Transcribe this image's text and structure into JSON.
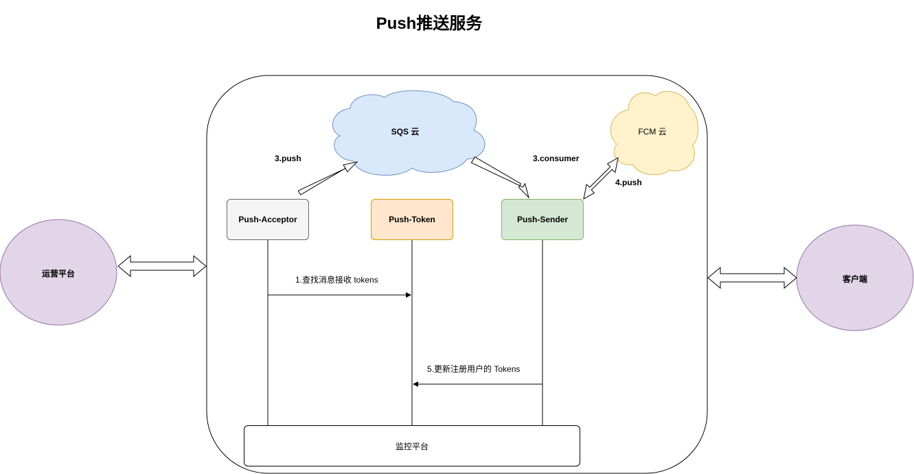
{
  "title": "Push推送服务",
  "nodes": {
    "ops_platform": "运营平台",
    "client": "客户端",
    "sqs_cloud": "SQS 云",
    "fcm_cloud": "FCM 云",
    "push_acceptor": "Push-Acceptor",
    "push_token": "Push-Token",
    "push_sender": "Push-Sender",
    "monitor_platform": "监控平台"
  },
  "edge_labels": {
    "push_to_sqs": "3.push",
    "sqs_consumer": "3.consumer",
    "fcm_push": "4.push",
    "lookup_tokens": "1.查找消息接收 tokens",
    "update_tokens": "5.更新注册用户的 Tokens"
  },
  "colors": {
    "ops_fill": "#e1d5e7",
    "ops_stroke": "#9673a6",
    "sqs_fill": "#dae8fc",
    "sqs_stroke": "#6c8ebf",
    "fcm_fill": "#fff2cc",
    "fcm_stroke": "#d6b656",
    "acceptor_fill": "#f5f5f5",
    "acceptor_stroke": "#666666",
    "token_fill": "#ffe6cc",
    "token_stroke": "#d79b00",
    "sender_fill": "#d5e8d4",
    "sender_stroke": "#82b366"
  }
}
